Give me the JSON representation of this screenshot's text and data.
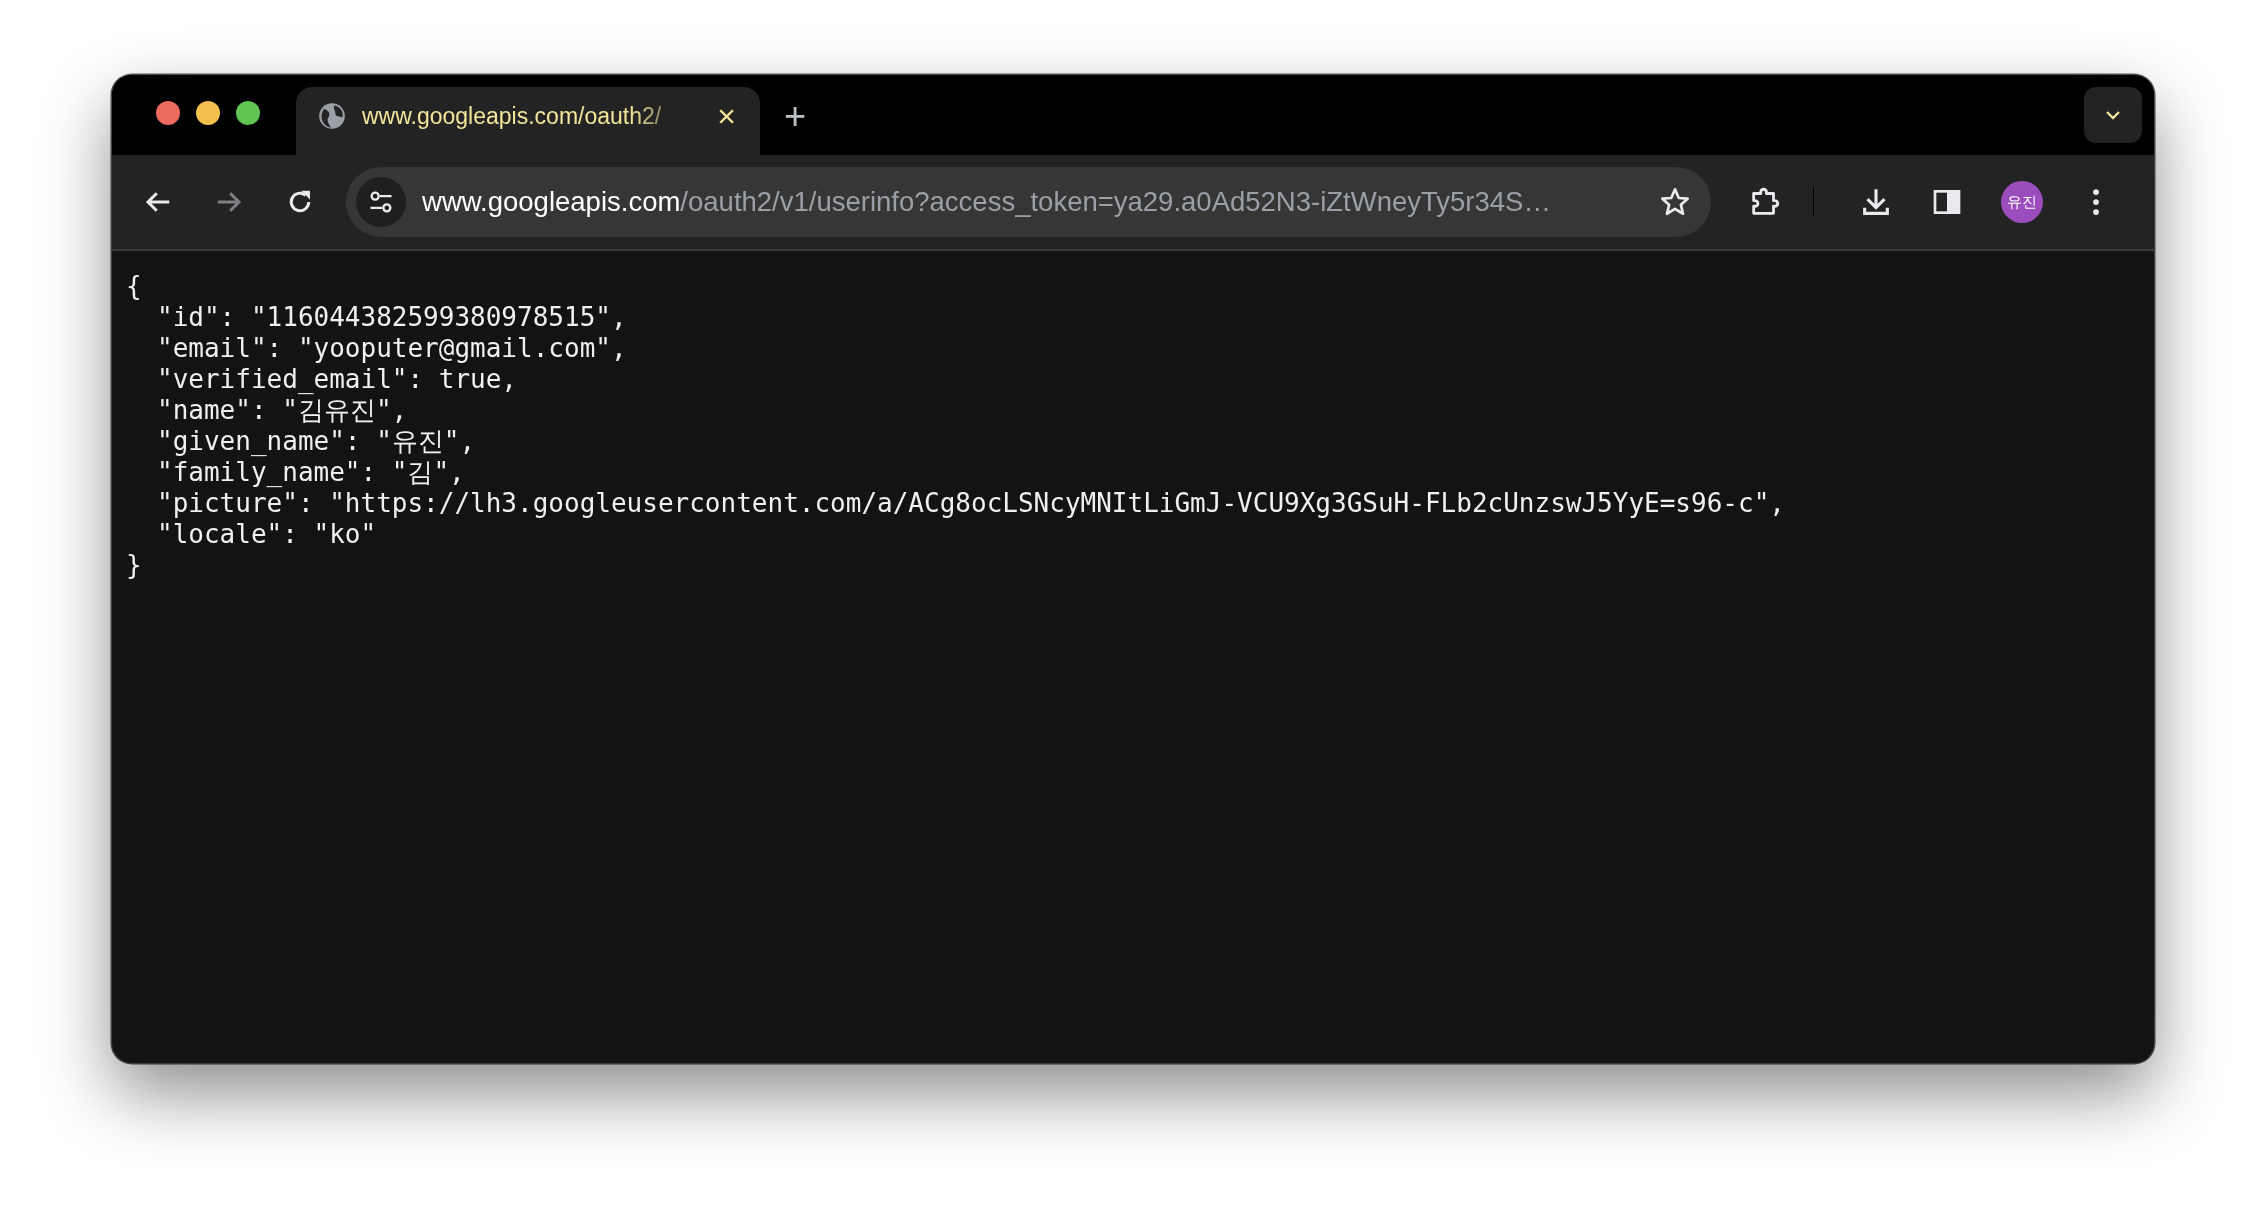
{
  "tab": {
    "title": "www.googleapis.com/oauth2/",
    "selected": true,
    "close": "×"
  },
  "new_tab": "+",
  "address_bar": {
    "host": "www.googleapis.com",
    "path": "/oauth2/v1/userinfo?access_token=ya29.a0Ad52N3-iZtWneyTy5r34S…"
  },
  "profile": {
    "initials": "유진",
    "color": "#9b4dbd"
  },
  "content": {
    "open": "{",
    "entries": [
      "\"id\": \"116044382599380978515\",",
      "\"email\": \"yooputer@gmail.com\",",
      "\"verified_email\": true,",
      "\"name\": \"김유진\",",
      "\"given_name\": \"유진\",",
      "\"family_name\": \"김\",",
      "\"picture\": \"https://lh3.googleusercontent.com/a/ACg8ocLSNcyMNItLiGmJ-VCU9Xg3GSuH-FLb2cUnzswJ5YyE=s96-c\",",
      "\"locale\": \"ko\""
    ],
    "close": "}"
  }
}
